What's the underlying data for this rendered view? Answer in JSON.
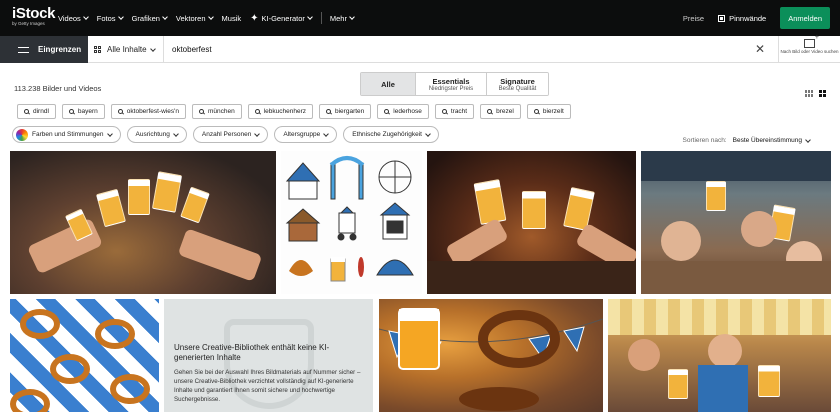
{
  "header": {
    "logo": "iStock",
    "logo_sub": "by Getty Images",
    "nav": [
      {
        "label": "Videos"
      },
      {
        "label": "Fotos"
      },
      {
        "label": "Grafiken"
      },
      {
        "label": "Vektoren"
      },
      {
        "label": "Musik"
      },
      {
        "label": "KI-Generator"
      },
      {
        "label": "Mehr"
      }
    ],
    "preise": "Preise",
    "pinnwaende": "Pinnwände",
    "anmelden": "Anmelden"
  },
  "search": {
    "filter_label": "Eingrenzen",
    "content_type": "Alle Inhalte",
    "query": "oktoberfest",
    "image_search_label": "Nach Bild oder Video suchen"
  },
  "results": {
    "count": "113.238 Bilder und Videos",
    "tabs": [
      {
        "title": "Alle",
        "sub": ""
      },
      {
        "title": "Essentials",
        "sub": "Niedrigster Preis"
      },
      {
        "title": "Signature",
        "sub": "Beste Qualität"
      }
    ]
  },
  "related": [
    "dirndl",
    "bayern",
    "oktoberfest-wies'n",
    "münchen",
    "lebkuchenherz",
    "biergarten",
    "lederhose",
    "tracht",
    "brezel",
    "bierzelt"
  ],
  "filters": [
    "Farben und Stimmungen",
    "Ausrichtung",
    "Anzahl Personen",
    "Altersgruppe",
    "Ethnische Zugehörigkeit"
  ],
  "sort": {
    "label": "Sortieren nach:",
    "value": "Beste Übereinstimmung"
  },
  "creative_notice": {
    "title": "Unsere Creative-Bibliothek enthält keine KI-generierten Inhalte",
    "body": "Gehen Sie bei der Auswahl Ihres Bildmaterials auf Nummer sicher – unsere Creative-Bibliothek verzichtet vollständig auf KI-generierte Inhalte und garantiert Ihnen somit sichere und hochwertige Suchergebnisse."
  },
  "colors": {
    "accent": "#0b8f5a",
    "nav_bg": "#0c0d0d",
    "filter_bg": "#2d3136"
  }
}
